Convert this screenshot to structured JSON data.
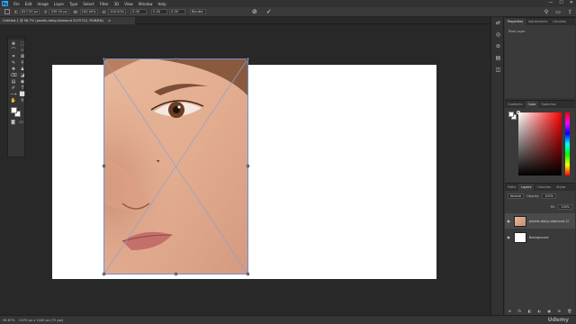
{
  "menubar": {
    "logo": "Ps",
    "items": [
      "File",
      "Edit",
      "Image",
      "Layer",
      "Type",
      "Select",
      "Filter",
      "3D",
      "View",
      "Window",
      "Help"
    ],
    "window_buttons": [
      "—",
      "☐",
      "✕"
    ]
  },
  "optionsbar": {
    "x_label": "X:",
    "x_value": "817.00 px",
    "y_label": "Y:",
    "y_value": "539.50 px",
    "w_label": "W:",
    "w_value": "100.00%",
    "h_label": "H:",
    "h_value": "100.00%",
    "angle_value": "0.00",
    "h_skew": "0.00",
    "v_skew": "0.00",
    "interp": "Bicubic",
    "cancel_icon": "⊘",
    "commit_icon": "✓"
  },
  "doc_tab": {
    "title": "Untitled-1 @ 56.7% (pexels-daisy-diamond 2075722, RGB/8#)",
    "close": "×"
  },
  "tools": [
    "✥",
    "⬚",
    "⌒",
    "⊹",
    "⌗",
    "⊠",
    "✎",
    "⚲",
    "✚",
    "♟",
    "⌫",
    "◪",
    "▤",
    "◉",
    "✐",
    "T",
    "⟶",
    "⬜",
    "✋",
    "⚲"
  ],
  "right_panels": {
    "properties": {
      "tabs": [
        "Properties",
        "Adjustments",
        "Libraries"
      ],
      "label": "Pixel Layer"
    },
    "color": {
      "tabs": [
        "Gradients",
        "Color",
        "Swatches"
      ]
    },
    "layers": {
      "tabs": [
        "Paths",
        "Layers",
        "Channels",
        "Styles"
      ],
      "blend_mode": "Normal",
      "opacity_label": "Opacity:",
      "opacity_value": "100%",
      "fill_label": "Fill:",
      "fill_value": "100%",
      "rows": [
        {
          "name": "pexels-daisy-diamond-2075722",
          "visible": true,
          "selected": true
        },
        {
          "name": "Background",
          "visible": true,
          "selected": false
        }
      ],
      "bottom_icons": [
        "⊕",
        "fx",
        "◧",
        "◐",
        "▣",
        "⊞",
        "🗑"
      ]
    }
  },
  "icon_column": [
    "⇄",
    "◎",
    "⊜",
    "▤",
    "◫"
  ],
  "status": {
    "zoom": "56.67%",
    "doc_size": "2070 px x 1440 px (72 ppi)",
    "watermark": "Udemy"
  },
  "colors": {
    "accent": "#31a8ff",
    "transform_line": "#6f8fd0",
    "panel_bg": "#3a3a3a",
    "canvas_bg": "#282828"
  }
}
